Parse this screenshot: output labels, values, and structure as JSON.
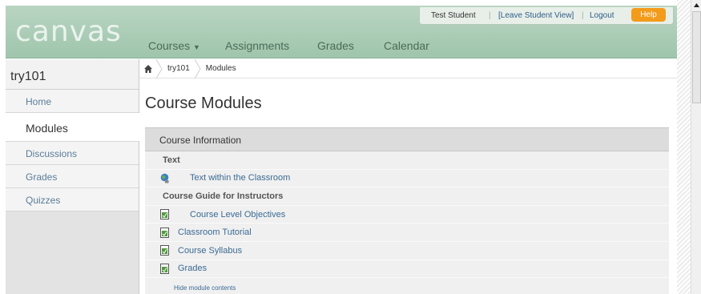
{
  "header": {
    "logo": "canvas",
    "user_name": "Test Student",
    "leave_student_view": "[Leave Student View]",
    "logout": "Logout",
    "help": "Help",
    "nav": [
      {
        "label": "Courses",
        "has_caret": true
      },
      {
        "label": "Assignments"
      },
      {
        "label": "Grades"
      },
      {
        "label": "Calendar"
      }
    ]
  },
  "sidebar": {
    "course_title": "try101",
    "items": [
      {
        "label": "Home",
        "active": false
      },
      {
        "label": "Modules",
        "active": true
      },
      {
        "label": "Discussions",
        "active": false
      },
      {
        "label": "Grades",
        "active": false
      },
      {
        "label": "Quizzes",
        "active": false
      }
    ]
  },
  "breadcrumb": {
    "course": "try101",
    "page": "Modules"
  },
  "page_title": "Course Modules",
  "module": {
    "name": "Course Information",
    "rows": [
      {
        "type": "header",
        "label": "Text"
      },
      {
        "type": "item",
        "icon": "globe-icon",
        "label": "Text within the Classroom",
        "indent": true
      },
      {
        "type": "header",
        "label": "Course Guide for Instructors"
      },
      {
        "type": "item",
        "icon": "document-icon",
        "label": "Course Level Objectives",
        "indent": true
      },
      {
        "type": "item",
        "icon": "document-icon",
        "label": "Classroom Tutorial",
        "indent": false
      },
      {
        "type": "item",
        "icon": "document-icon",
        "label": "Course Syllabus",
        "indent": false
      },
      {
        "type": "item",
        "icon": "document-icon",
        "label": "Grades",
        "indent": false
      }
    ],
    "hide_link": "Hide module contents"
  },
  "colors": {
    "header_bg": "#a9ccb5",
    "help_orange": "#f39b1a",
    "link_blue": "#3a6a94"
  }
}
